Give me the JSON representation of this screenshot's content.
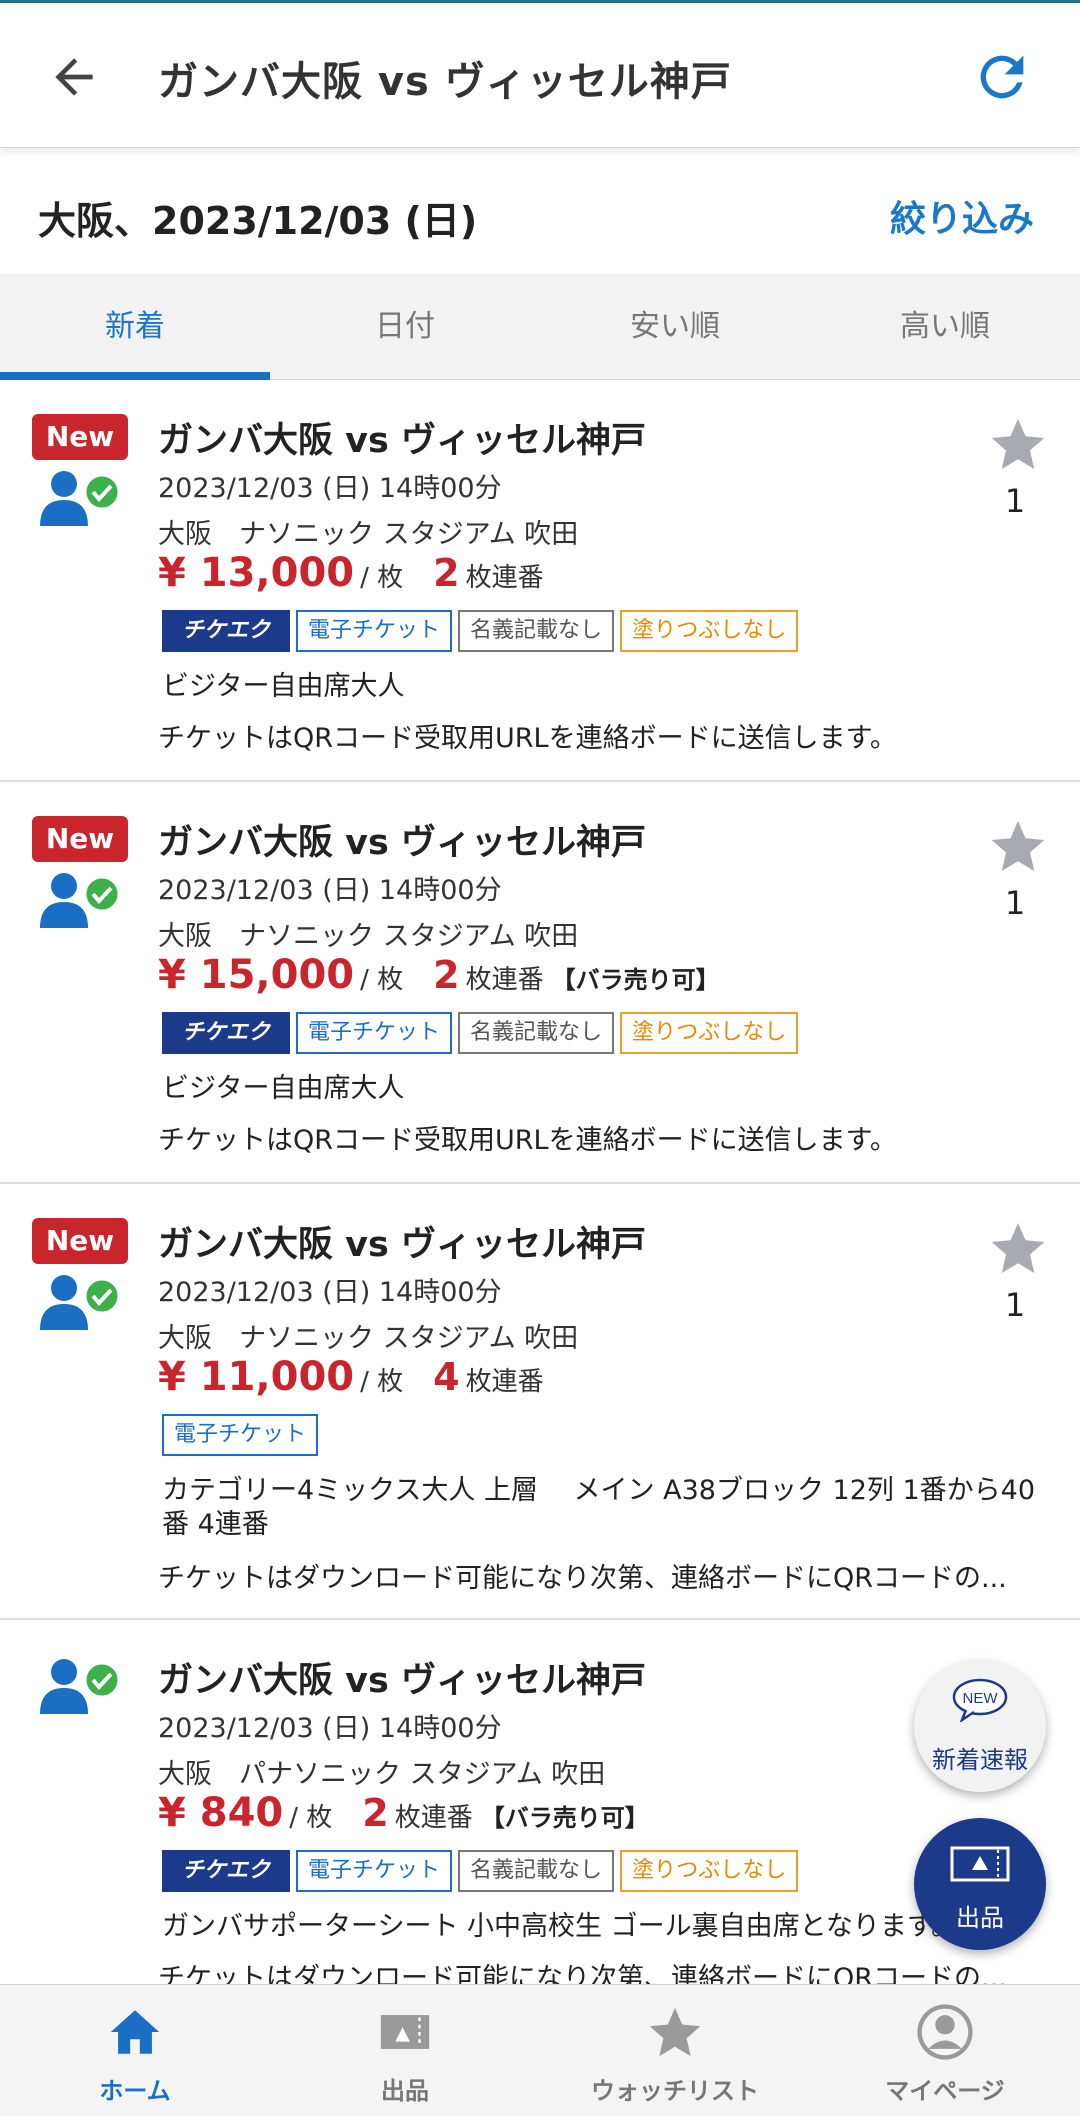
{
  "header": {
    "title": "ガンバ大阪 vs ヴィッセル神戸",
    "icons": [
      "back-arrow-icon",
      "refresh-icon"
    ]
  },
  "subheader": {
    "location_date": "大阪、2023/12/03 (日)",
    "filter_label": "絞り込み"
  },
  "tabs": [
    {
      "label": "新着",
      "active": true
    },
    {
      "label": "日付",
      "active": false
    },
    {
      "label": "安い順",
      "active": false
    },
    {
      "label": "高い順",
      "active": false
    }
  ],
  "colors": {
    "accent": "#1a78c8",
    "price_red": "#c8262c",
    "navy": "#1b3a8a",
    "verified_green": "#3db04b"
  },
  "listings": [
    {
      "new_badge": "New",
      "title": "ガンバ大阪 vs ヴィッセル神戸",
      "datetime": "2023/12/03 (日) 14時00分",
      "venue": "大阪　ナソニック スタジアム 吹田",
      "price": "¥ 13,000",
      "price_unit": "/ 枚",
      "count": "2",
      "count_unit": "枚連番",
      "bara": "",
      "tags": [
        "チケエク",
        "電子チケット",
        "名義記載なし",
        "塗りつぶしなし"
      ],
      "seat": "ビジター自由席大人",
      "note": "チケットはQRコード受取用URLを連絡ボードに送信します。",
      "watch_count": "1"
    },
    {
      "new_badge": "New",
      "title": "ガンバ大阪 vs ヴィッセル神戸",
      "datetime": "2023/12/03 (日) 14時00分",
      "venue": "大阪　ナソニック スタジアム 吹田",
      "price": "¥ 15,000",
      "price_unit": "/ 枚",
      "count": "2",
      "count_unit": "枚連番",
      "bara": "【バラ売り可】",
      "tags": [
        "チケエク",
        "電子チケット",
        "名義記載なし",
        "塗りつぶしなし"
      ],
      "seat": "ビジター自由席大人",
      "note": "チケットはQRコード受取用URLを連絡ボードに送信します。",
      "watch_count": "1"
    },
    {
      "new_badge": "New",
      "title": "ガンバ大阪 vs ヴィッセル神戸",
      "datetime": "2023/12/03 (日) 14時00分",
      "venue": "大阪　ナソニック スタジアム 吹田",
      "price": "¥ 11,000",
      "price_unit": "/ 枚",
      "count": "4",
      "count_unit": "枚連番",
      "bara": "",
      "tags": [
        "電子チケット"
      ],
      "seat": "カテゴリー4ミックス大人 上層　 メイン A38ブロック 12列 1番から40番 4連番",
      "note": "チケットはダウンロード可能になり次第、連絡ボードにQRコードの...",
      "watch_count": "1"
    },
    {
      "new_badge": "",
      "title": "ガンバ大阪 vs ヴィッセル神戸",
      "datetime": "2023/12/03 (日) 14時00分",
      "venue": "大阪　パナソニック スタジアム 吹田",
      "price": "¥ 840",
      "price_unit": "/ 枚",
      "count": "2",
      "count_unit": "枚連番",
      "bara": "【バラ売り可】",
      "tags": [
        "チケエク",
        "電子チケット",
        "名義記載なし",
        "塗りつぶしなし"
      ],
      "seat": "ガンバサポーターシート 小中高校生 ゴール裏自由席となります。",
      "note": "チケットはダウンロード可能になり次第、連絡ボードにQRコードの...",
      "watch_count": ""
    }
  ],
  "fab": {
    "new_alert_badge": "NEW",
    "new_alert_label": "新着速報",
    "sell_label": "出品"
  },
  "bottom_nav": [
    {
      "label": "ホーム",
      "icon": "home-icon",
      "active": true
    },
    {
      "label": "出品",
      "icon": "sell-icon",
      "active": false
    },
    {
      "label": "ウォッチリスト",
      "icon": "star-icon",
      "active": false
    },
    {
      "label": "マイページ",
      "icon": "person-icon",
      "active": false
    }
  ]
}
